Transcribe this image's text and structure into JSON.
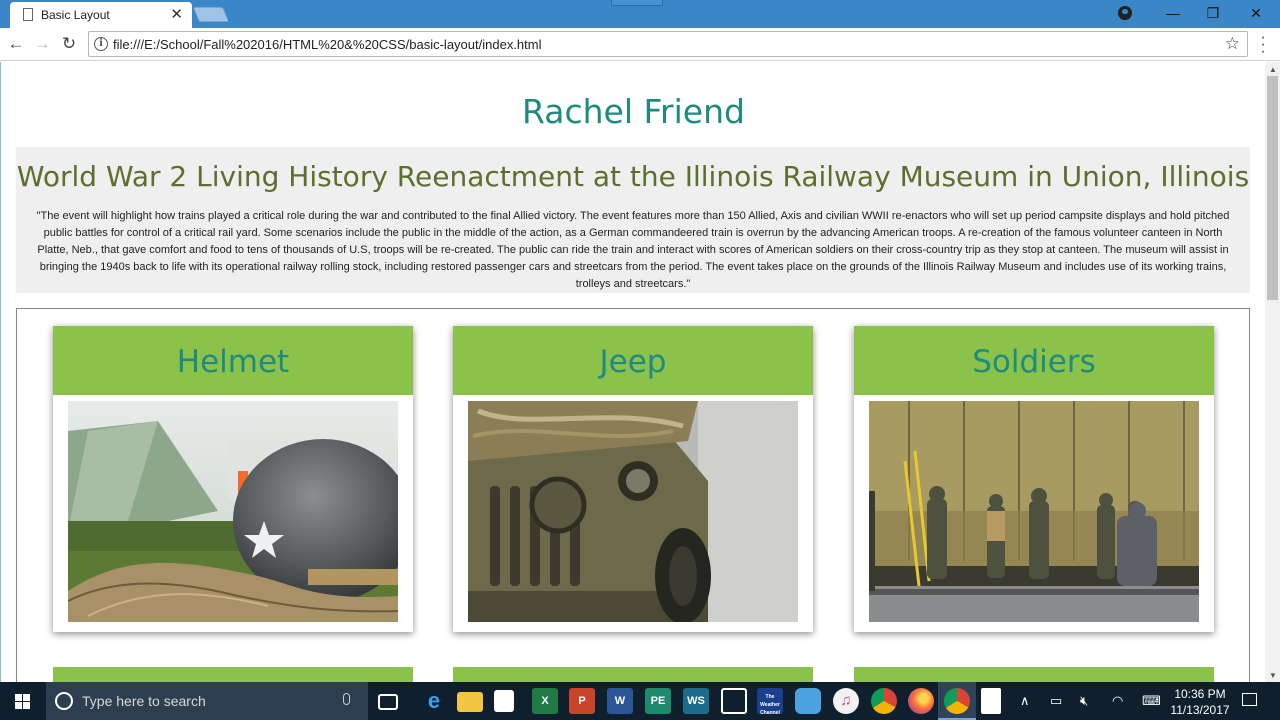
{
  "browser": {
    "tab_title": "Basic Layout",
    "tab_close": "✕",
    "url": "file:///E:/School/Fall%202016/HTML%20&%20CSS/basic-layout/index.html",
    "info_glyph": "i",
    "window_controls": {
      "minimize": "—",
      "restore": "❐",
      "close": "✕"
    }
  },
  "page": {
    "site_title": "Rachel Friend",
    "intro_heading": "World War 2 Living History Reenactment at the Illinois Railway Museum in Union, Illinois",
    "intro_text": "\"The event will highlight how trains played a critical role during the war and contributed to the final Allied victory. The event features more than 150 Allied, Axis and civilian WWII re-enactors who will set up period campsite displays and hold pitched public battles for control of a critical rail yard. Some scenarios include the public in the middle of the action, as a German commandeered train is overrun by the advancing American troops. A re-creation of the famous volunteer canteen in North Platte, Neb., that gave comfort and food to tens of thousands of U.S, troops will be re-created. The public can ride the train and interact with scores of American soldiers on their cross-country trip as they stop at canteen. The museum will assist in bringing the 1940s back to life with its operational railway rolling stock, including restored passenger cars and streetcars from the period. The event takes place on the grounds of the Illinois Railway Museum and includes use of its working trains, trolleys and streetcars.\"",
    "cards": [
      {
        "title": "Helmet"
      },
      {
        "title": "Jeep"
      },
      {
        "title": "Soldiers"
      }
    ]
  },
  "taskbar": {
    "search_placeholder": "Type here to search",
    "time": "10:36 PM",
    "date": "11/13/2017",
    "apps": [
      "task-view",
      "edge",
      "file-explorer",
      "store",
      "excel",
      "powerpoint",
      "word",
      "publisher",
      "visual-studio",
      "app",
      "the-weather-channel",
      "photos",
      "itunes",
      "chrome",
      "firefox",
      "chrome",
      "document"
    ],
    "app_labels": {
      "excel": "X",
      "powerpoint": "P",
      "word": "W",
      "publisher": "PE",
      "weather": "The Weather Channel"
    }
  },
  "colors": {
    "titlebar": "#3b86c6",
    "site_title": "#1e8a80",
    "intro_heading": "#5d6e2e",
    "card_header": "#8bc34a",
    "taskbar": "#101f2d"
  }
}
